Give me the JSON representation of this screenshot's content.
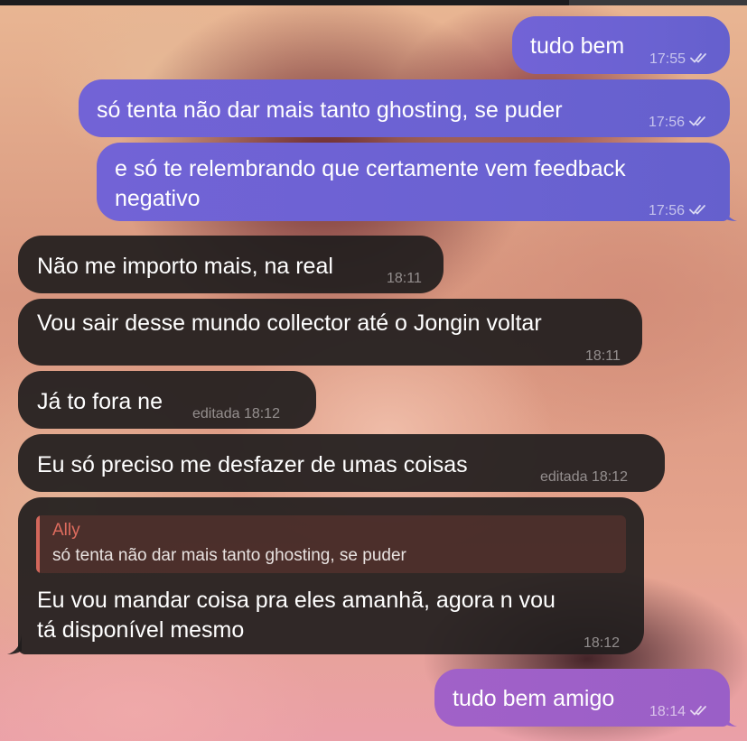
{
  "colors": {
    "outgoing_bubble": "#6c62d2",
    "outgoing_bubble_last": "#9f60c8",
    "incoming_bubble": "#211e1e",
    "reply_accent": "#de6c5e"
  },
  "messages": [
    {
      "direction": "outgoing",
      "text": "tudo bem",
      "time": "17:55",
      "status_icon": "double-check-icon"
    },
    {
      "direction": "outgoing",
      "text": "só tenta não dar mais tanto ghosting, se puder",
      "time": "17:56",
      "status_icon": "double-check-icon"
    },
    {
      "direction": "outgoing",
      "text_lines": [
        "e só te relembrando que certamente vem feedback",
        "negativo"
      ],
      "time": "17:56",
      "status_icon": "double-check-icon"
    },
    {
      "direction": "incoming",
      "text": "Não me importo mais, na real",
      "time": "18:11"
    },
    {
      "direction": "incoming",
      "text": "Vou sair desse mundo collector até o Jongin voltar",
      "time": "18:11"
    },
    {
      "direction": "incoming",
      "text": "Já to fora ne",
      "time": "editada 18:12"
    },
    {
      "direction": "incoming",
      "text": "Eu só preciso me desfazer de umas coisas",
      "time": "editada 18:12"
    },
    {
      "direction": "incoming",
      "reply_to": {
        "sender": "Ally",
        "text": "só tenta não dar mais tanto ghosting, se puder"
      },
      "text_lines": [
        "Eu vou mandar coisa pra eles amanhã, agora n vou",
        "tá disponível mesmo"
      ],
      "time": "18:12"
    },
    {
      "direction": "outgoing",
      "text": "tudo bem amigo",
      "time": "18:14",
      "status_icon": "double-check-icon"
    }
  ]
}
